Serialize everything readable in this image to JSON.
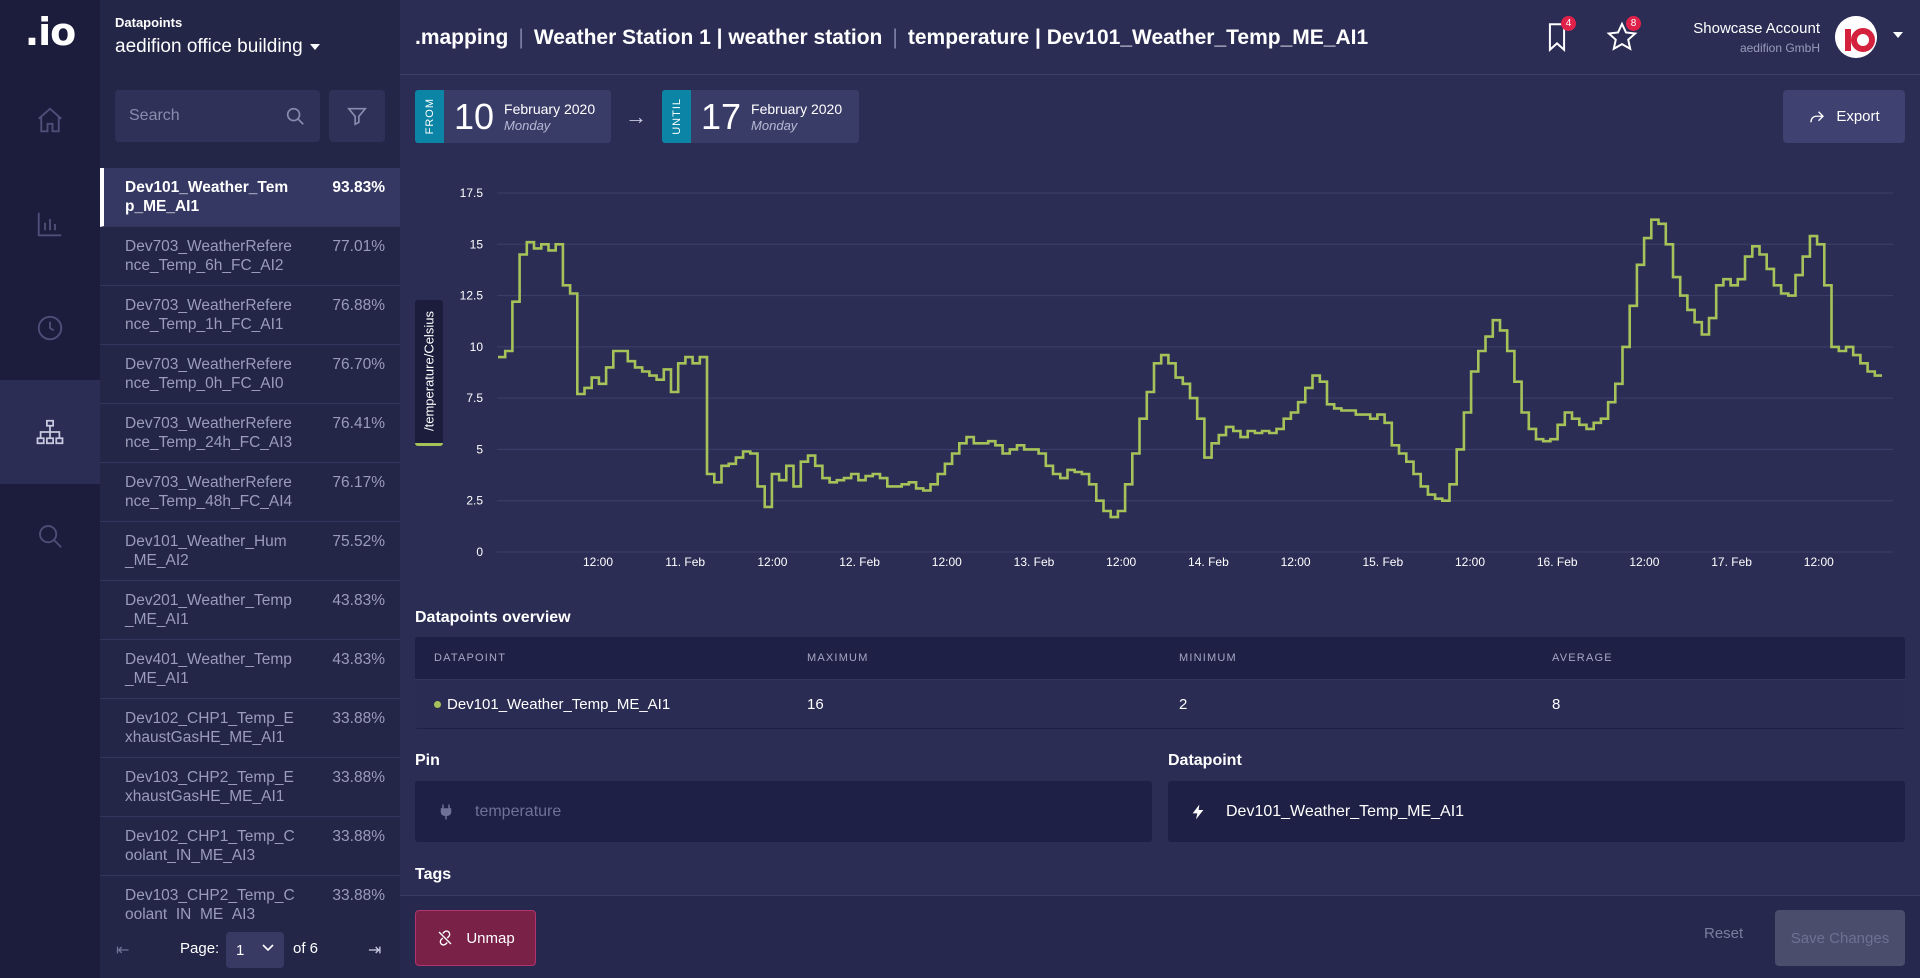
{
  "app": {
    "logo": ".io"
  },
  "nav": {
    "items": [
      {
        "name": "home",
        "icon": "home-icon",
        "active": false
      },
      {
        "name": "charts",
        "icon": "bar-chart-icon",
        "active": false
      },
      {
        "name": "history",
        "icon": "clock-icon",
        "active": false
      },
      {
        "name": "mapping",
        "icon": "hierarchy-icon",
        "active": true
      },
      {
        "name": "search",
        "icon": "search-icon",
        "active": false
      }
    ]
  },
  "sidebar": {
    "label": "Datapoints",
    "building": "aedifion office building",
    "search_placeholder": "Search",
    "items": [
      {
        "name": "Dev101_Weather_Temp_ME_AI1",
        "score": "93.83%"
      },
      {
        "name": "Dev703_WeatherReference_Temp_6h_FC_AI2",
        "score": "77.01%"
      },
      {
        "name": "Dev703_WeatherReference_Temp_1h_FC_AI1",
        "score": "76.88%"
      },
      {
        "name": "Dev703_WeatherReference_Temp_0h_FC_AI0",
        "score": "76.70%"
      },
      {
        "name": "Dev703_WeatherReference_Temp_24h_FC_AI3",
        "score": "76.41%"
      },
      {
        "name": "Dev703_WeatherReference_Temp_48h_FC_AI4",
        "score": "76.17%"
      },
      {
        "name": "Dev101_Weather_Hum_ME_AI2",
        "score": "75.52%"
      },
      {
        "name": "Dev201_Weather_Temp_ME_AI1",
        "score": "43.83%"
      },
      {
        "name": "Dev401_Weather_Temp_ME_AI1",
        "score": "43.83%"
      },
      {
        "name": "Dev102_CHP1_Temp_ExhaustGasHE_ME_AI1",
        "score": "33.88%"
      },
      {
        "name": "Dev103_CHP2_Temp_ExhaustGasHE_ME_AI1",
        "score": "33.88%"
      },
      {
        "name": "Dev102_CHP1_Temp_Coolant_IN_ME_AI3",
        "score": "33.88%"
      },
      {
        "name": "Dev103_CHP2_Temp_Coolant_IN_ME_AI3",
        "score": "33.88%"
      }
    ],
    "pager": {
      "label": "Page:",
      "current": "1",
      "of": "of 6"
    }
  },
  "header": {
    "crumbs": [
      ".mapping",
      "Weather Station 1 | weather station",
      "temperature | Dev101_Weather_Temp_ME_AI1"
    ],
    "bookmarks_count": "4",
    "favorites_count": "8",
    "account_name": "Showcase Account",
    "account_org": "aedifion GmbH"
  },
  "range": {
    "from_tag": "FROM",
    "from_day": "10",
    "from_month": "February 2020",
    "from_weekday": "Monday",
    "until_tag": "UNTIL",
    "until_day": "17",
    "until_month": "February 2020",
    "until_weekday": "Monday",
    "export_label": "Export"
  },
  "chart_data": {
    "type": "line",
    "ylabel": "/temperature/Celsius",
    "ylim": [
      0,
      17.5
    ],
    "yticks": [
      "0",
      "2.5",
      "5",
      "7.5",
      "10",
      "12.5",
      "15",
      "17.5"
    ],
    "x_tick_labels": [
      "12:00",
      "11. Feb",
      "12:00",
      "12. Feb",
      "12:00",
      "13. Feb",
      "12:00",
      "14. Feb",
      "12:00",
      "15. Feb",
      "12:00",
      "16. Feb",
      "12:00",
      "17. Feb",
      "12:00"
    ],
    "series": [
      {
        "color": "#a6c35a",
        "values": [
          9.5,
          9.8,
          12.2,
          14.5,
          15.1,
          14.8,
          15.0,
          14.7,
          15.0,
          13.0,
          12.6,
          7.7,
          8.0,
          8.5,
          8.2,
          9.0,
          9.8,
          9.8,
          9.3,
          9.0,
          8.8,
          8.6,
          8.4,
          8.9,
          7.8,
          9.2,
          9.5,
          9.2,
          9.5,
          3.8,
          3.4,
          4.2,
          4.3,
          4.6,
          4.9,
          4.8,
          3.2,
          2.2,
          3.8,
          3.5,
          4.2,
          3.2,
          4.4,
          4.7,
          4.2,
          3.6,
          3.4,
          3.5,
          3.6,
          3.8,
          3.5,
          3.7,
          3.8,
          3.6,
          3.2,
          3.2,
          3.3,
          3.4,
          3.1,
          3.0,
          3.3,
          3.8,
          4.3,
          4.8,
          5.3,
          5.6,
          5.3,
          5.3,
          5.4,
          5.2,
          4.8,
          5.0,
          5.2,
          5.0,
          5.0,
          4.8,
          4.2,
          3.8,
          3.6,
          4.0,
          3.9,
          3.8,
          3.3,
          2.5,
          2.0,
          1.7,
          2.0,
          3.3,
          4.8,
          6.5,
          7.8,
          9.2,
          9.6,
          9.2,
          8.5,
          8.2,
          7.5,
          6.5,
          4.6,
          5.3,
          5.7,
          6.1,
          5.9,
          5.6,
          5.9,
          5.8,
          5.9,
          5.8,
          6.0,
          6.5,
          6.8,
          7.3,
          8.0,
          8.6,
          8.3,
          7.2,
          7.0,
          6.9,
          6.9,
          6.7,
          6.7,
          6.5,
          6.7,
          6.3,
          5.2,
          4.8,
          4.4,
          3.8,
          3.2,
          2.8,
          2.6,
          2.5,
          3.3,
          5.0,
          6.8,
          8.8,
          9.8,
          10.5,
          11.3,
          10.8,
          9.8,
          8.3,
          6.8,
          6.0,
          5.5,
          5.4,
          5.5,
          6.2,
          6.8,
          6.5,
          6.2,
          6.0,
          6.3,
          6.5,
          7.3,
          8.2,
          10.0,
          12.0,
          14.0,
          15.3,
          16.2,
          16.0,
          15.0,
          13.4,
          12.5,
          11.8,
          11.2,
          10.6,
          11.4,
          13.0,
          13.3,
          13.0,
          13.3,
          14.4,
          14.9,
          14.5,
          13.8,
          13.0,
          12.6,
          12.5,
          13.5,
          14.4,
          15.4,
          15.0,
          13.0,
          10.0,
          9.8,
          10.0,
          9.6,
          9.2,
          8.8,
          8.6
        ]
      }
    ]
  },
  "overview": {
    "title": "Datapoints overview",
    "columns": [
      "DATAPOINT",
      "MAXIMUM",
      "MINIMUM",
      "AVERAGE"
    ],
    "row": {
      "datapoint": "Dev101_Weather_Temp_ME_AI1",
      "max": "16",
      "min": "2",
      "avg": "8"
    }
  },
  "pin": {
    "label": "Pin",
    "value": "temperature"
  },
  "datapoint": {
    "label": "Datapoint",
    "value": "Dev101_Weather_Temp_ME_AI1"
  },
  "tags": {
    "label": "Tags"
  },
  "footer": {
    "unmap_label": "Unmap",
    "reset_label": "Reset",
    "save_label": "Save Changes"
  }
}
